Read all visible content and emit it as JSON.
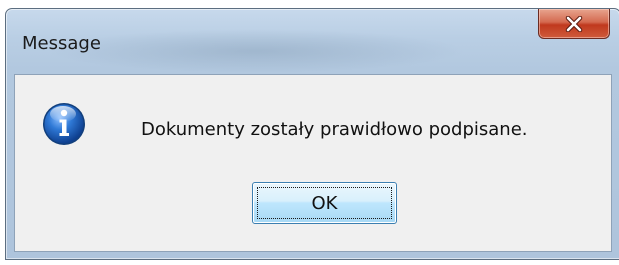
{
  "window": {
    "title": "Message",
    "close_icon": "close-icon"
  },
  "dialog": {
    "icon": "info-icon",
    "message": "Dokumenty zostały prawidłowo podpisane.",
    "ok_label": "OK"
  },
  "colors": {
    "titlebar": "#b9cee4",
    "close_button": "#c0391e",
    "client_bg": "#f0f0f0",
    "ok_button": "#bee6fd",
    "info_icon": "#1f5fb8"
  }
}
